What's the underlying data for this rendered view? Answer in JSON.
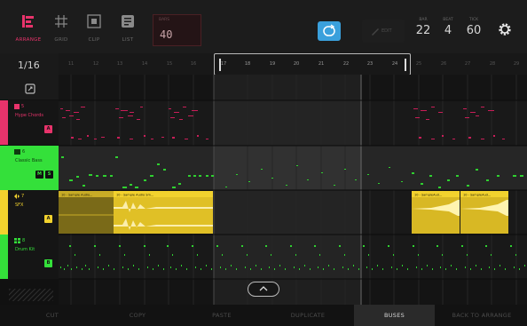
{
  "toolbar": {
    "arrange_label": "ARRANGE",
    "grid_label": "GRID",
    "clip_label": "CLIP",
    "list_label": "LIST",
    "bars_caption": "BARS",
    "bars_value": "40",
    "edit_label": "EDIT",
    "bar_caption": "BAR",
    "bar_value": "22",
    "beat_caption": "BEAT",
    "beat_value": "4",
    "tick_caption": "TICK",
    "tick_value": "60"
  },
  "grid": {
    "resolution": "1/16"
  },
  "ruler": {
    "bars": [
      "11",
      "12",
      "13",
      "14",
      "15",
      "16",
      "17",
      "18",
      "19",
      "20",
      "21",
      "22",
      "23",
      "24",
      "25",
      "26",
      "27",
      "28",
      "29"
    ]
  },
  "tracks": [
    {
      "number": "5",
      "name": "Hype Chords",
      "color": "#e8336b",
      "icon": "keyboard-icon",
      "chips": [
        "A"
      ]
    },
    {
      "number": "6",
      "name": "Classic Bass",
      "color": "#34e03a",
      "icon": "drum-icon",
      "chips": [
        "M",
        "S"
      ]
    },
    {
      "number": "7",
      "name": "SFX",
      "color": "#f2d22e",
      "icon": "audio-icon",
      "chips": [
        "A"
      ]
    },
    {
      "number": "8",
      "name": "Drum Kit",
      "color": "#34e03a",
      "icon": "pads-icon",
      "chips": [
        "B"
      ]
    }
  ],
  "audio_clips": {
    "clip1_label": "10 - Sample Audio...",
    "clip2_label": "10 - Sample Audio Sm...",
    "clip3_label": "10 - SampleAud...",
    "clip4_label": "10 - SampleAud..."
  },
  "actions": {
    "cut": "CUT",
    "copy": "COPY",
    "paste": "PASTE",
    "duplicate": "DUPLICATE",
    "buses": "BUSES",
    "back": "BACK TO ARRANGE"
  },
  "colors": {
    "accent": "#e8336b",
    "loop_blue": "#3aa0dc",
    "midi_pink": "#c81e58",
    "midi_green": "#2fd030",
    "audio_yellow": "#f2d22e"
  }
}
